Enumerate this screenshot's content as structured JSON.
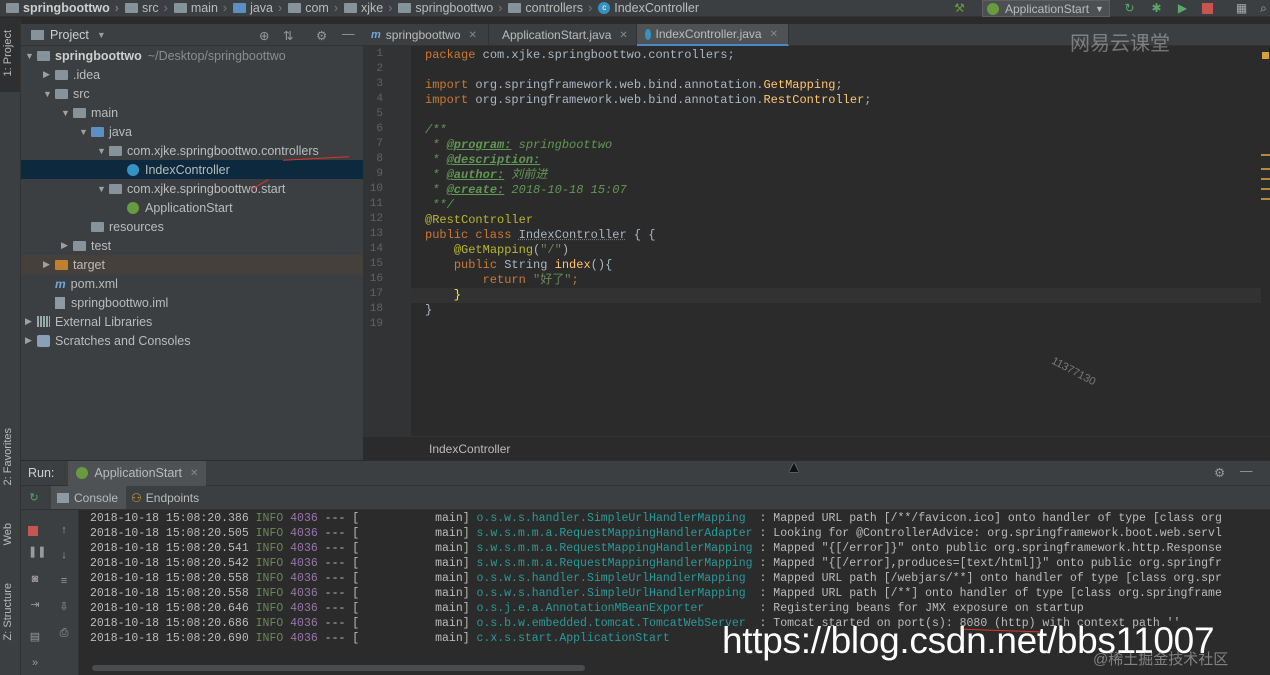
{
  "navbar": {
    "crumbs": [
      "springboottwo",
      "src",
      "main",
      "java",
      "com",
      "xjke",
      "springboottwo",
      "controllers",
      "IndexController"
    ],
    "run_config": "ApplicationStart"
  },
  "left_stripe": {
    "project_tab": "1: Project",
    "favorites_tab": "2: Favorites",
    "web_tab": "Web",
    "structure_tab": "Z: Structure"
  },
  "project_panel": {
    "title": "Project",
    "tree": [
      {
        "label": "springboottwo",
        "hint": "~/Desktop/springboottwo",
        "arrow": "▼",
        "icon": "folder",
        "indent": 0,
        "bold": true
      },
      {
        "label": ".idea",
        "arrow": "▶",
        "icon": "folder",
        "indent": 1
      },
      {
        "label": "src",
        "arrow": "▼",
        "icon": "folder",
        "indent": 1
      },
      {
        "label": "main",
        "arrow": "▼",
        "icon": "folder",
        "indent": 2
      },
      {
        "label": "java",
        "arrow": "▼",
        "icon": "folder-blue",
        "indent": 3
      },
      {
        "label": "com.xjke.springboottwo.controllers",
        "arrow": "▼",
        "icon": "folder",
        "indent": 4
      },
      {
        "label": "IndexController",
        "arrow": "",
        "icon": "class",
        "indent": 5,
        "selected": true
      },
      {
        "label": "com.xjke.springboottwo.start",
        "arrow": "▼",
        "icon": "folder",
        "indent": 4
      },
      {
        "label": "ApplicationStart",
        "arrow": "",
        "icon": "spring",
        "indent": 5
      },
      {
        "label": "resources",
        "arrow": "",
        "icon": "folder",
        "indent": 3
      },
      {
        "label": "test",
        "arrow": "▶",
        "icon": "folder",
        "indent": 2
      },
      {
        "label": "target",
        "arrow": "▶",
        "icon": "folder-orange",
        "indent": 1,
        "excluded": true
      },
      {
        "label": "pom.xml",
        "arrow": "",
        "icon": "maven",
        "indent": 1
      },
      {
        "label": "springboottwo.iml",
        "arrow": "",
        "icon": "file",
        "indent": 1
      },
      {
        "label": "External Libraries",
        "arrow": "▶",
        "icon": "lib",
        "indent": 0
      },
      {
        "label": "Scratches and Consoles",
        "arrow": "▶",
        "icon": "scratch",
        "indent": 0
      }
    ]
  },
  "editor": {
    "tabs": [
      {
        "label": "springboottwo",
        "icon": "maven",
        "active": false
      },
      {
        "label": "ApplicationStart.java",
        "icon": "class",
        "active": false
      },
      {
        "label": "IndexController.java",
        "icon": "class",
        "active": true
      }
    ],
    "line_numbers": [
      "1",
      "2",
      "3",
      "4",
      "5",
      "6",
      "7",
      "8",
      "9",
      "10",
      "11",
      "12",
      "13",
      "14",
      "15",
      "16",
      "17",
      "18",
      "19"
    ],
    "code": {
      "l1_kw": "package",
      "l1_rest": " com.xjke.springboottwo.controllers;",
      "l3_kw": "import",
      "l3_a": " org.springframework.web.bind.annotation.",
      "l3_b": "GetMapping",
      "l3_c": ";",
      "l4_kw": "import",
      "l4_a": " org.springframework.web.bind.annotation.",
      "l4_b": "RestController",
      "l4_c": ";",
      "l6": "/**",
      "l7_a": " * ",
      "l7_tag": "@program:",
      "l7_val": " springboottwo",
      "l8_a": " * ",
      "l8_tag": "@description:",
      "l9_a": " * ",
      "l9_tag": "@author:",
      "l9_val": " 刘前进",
      "l10_a": " * ",
      "l10_tag": "@create:",
      "l10_val": " 2018-10-18 15:07",
      "l11": " **/",
      "l12": "@RestController",
      "l13_a": "public class ",
      "l13_b": "IndexController",
      " l13_c": " {",
      "l14_a": "    ",
      "l14_ann": "@GetMapping",
      "l14_b": "(",
      "l14_str": "\"/\"",
      "l14_c": ")",
      "l15_a": "    ",
      "l15_kw": "public ",
      "l15_b": "String ",
      "l15_fn": "index",
      "l15_c": "(){",
      "l16_a": "        ",
      "l16_kw": "return ",
      "l16_str": "\"好了\"",
      "l16_c": ";",
      "l17": "    }",
      "l18": "}"
    },
    "bottom_breadcrumb": "IndexController"
  },
  "run_panel": {
    "run_label": "Run:",
    "config": "ApplicationStart",
    "tabs": [
      "Console",
      "Endpoints"
    ],
    "log": [
      {
        "ts": "2018-10-18 15:08:20.386",
        "lvl": "INFO",
        "pid": "4036",
        "sep": "---",
        "thr": "[           main]",
        "cls": "o.s.w.s.handler.SimpleUrlHandlerMapping ",
        "msg": ": Mapped URL path [/**/favicon.ico] onto handler of type [class org"
      },
      {
        "ts": "2018-10-18 15:08:20.505",
        "lvl": "INFO",
        "pid": "4036",
        "sep": "---",
        "thr": "[           main]",
        "cls": "s.w.s.m.m.a.RequestMappingHandlerAdapter",
        "msg": ": Looking for @ControllerAdvice: org.springframework.boot.web.servl"
      },
      {
        "ts": "2018-10-18 15:08:20.541",
        "lvl": "INFO",
        "pid": "4036",
        "sep": "---",
        "thr": "[           main]",
        "cls": "s.w.s.m.m.a.RequestMappingHandlerMapping",
        "msg": ": Mapped \"{[/error]}\" onto public org.springframework.http.Response"
      },
      {
        "ts": "2018-10-18 15:08:20.542",
        "lvl": "INFO",
        "pid": "4036",
        "sep": "---",
        "thr": "[           main]",
        "cls": "s.w.s.m.m.a.RequestMappingHandlerMapping",
        "msg": ": Mapped \"{[/error],produces=[text/html]}\" onto public org.springfr"
      },
      {
        "ts": "2018-10-18 15:08:20.558",
        "lvl": "INFO",
        "pid": "4036",
        "sep": "---",
        "thr": "[           main]",
        "cls": "o.s.w.s.handler.SimpleUrlHandlerMapping ",
        "msg": ": Mapped URL path [/webjars/**] onto handler of type [class org.spr"
      },
      {
        "ts": "2018-10-18 15:08:20.558",
        "lvl": "INFO",
        "pid": "4036",
        "sep": "---",
        "thr": "[           main]",
        "cls": "o.s.w.s.handler.SimpleUrlHandlerMapping ",
        "msg": ": Mapped URL path [/**] onto handler of type [class org.springframe"
      },
      {
        "ts": "2018-10-18 15:08:20.646",
        "lvl": "INFO",
        "pid": "4036",
        "sep": "---",
        "thr": "[           main]",
        "cls": "o.s.j.e.a.AnnotationMBeanExporter       ",
        "msg": ": Registering beans for JMX exposure on startup"
      },
      {
        "ts": "2018-10-18 15:08:20.686",
        "lvl": "INFO",
        "pid": "4036",
        "sep": "---",
        "thr": "[           main]",
        "cls": "o.s.b.w.embedded.tomcat.TomcatWebServer ",
        "msg": ": Tomcat started on port(s): 8080 (http) with context path ''"
      },
      {
        "ts": "2018-10-18 15:08:20.690",
        "lvl": "INFO",
        "pid": "4036",
        "sep": "---",
        "thr": "[           main]",
        "cls": "c.x.s.start.ApplicationStart            ",
        "msg": ""
      }
    ]
  },
  "watermarks": {
    "url": "https://blog.csdn.net/bbs11007",
    "logo": "网易云课堂",
    "number": "11377130",
    "juejin": "@稀土掘金技术社区"
  },
  "colors": {
    "accent": "#4a88c7",
    "selection": "#0d293e",
    "keyword": "#cc7832",
    "annotation": "#bbb529",
    "string": "#6a8759",
    "doc": "#629755"
  }
}
